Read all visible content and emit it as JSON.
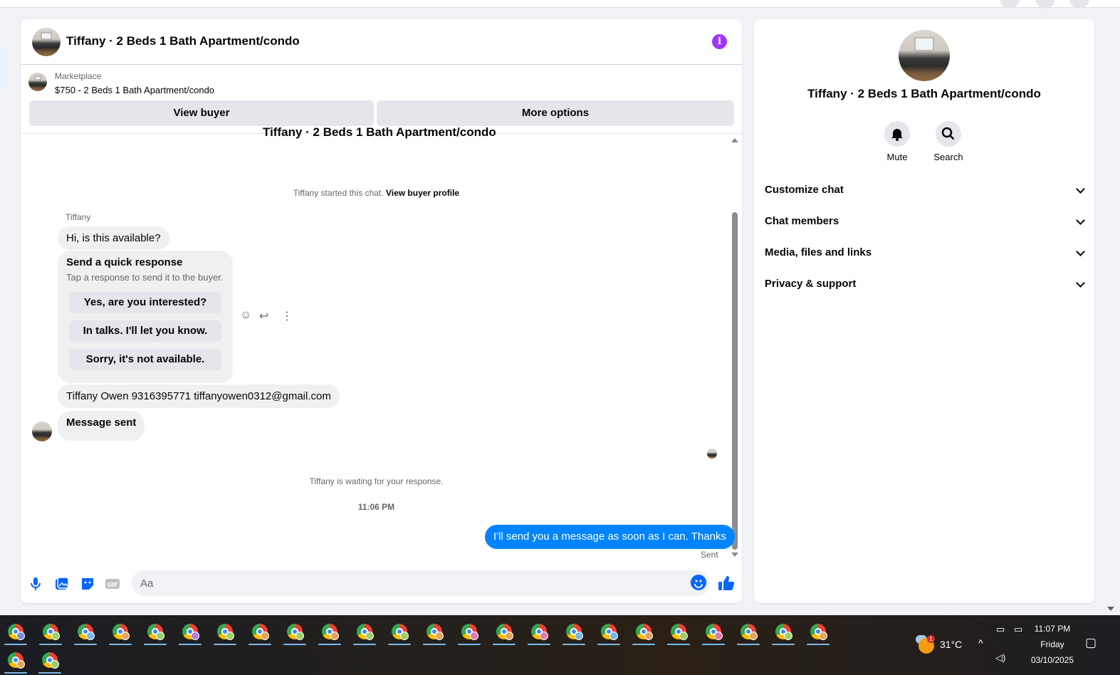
{
  "header": {
    "title": "Tiffany · 2 Beds 1 Bath Apartment/condo"
  },
  "listing": {
    "source": "Marketplace",
    "title": "$750 - 2 Beds 1 Bath Apartment/condo",
    "view_buyer": "View buyer",
    "more_options": "More options"
  },
  "conversation": {
    "clipped_title": "Tiffany · 2 Beds 1 Bath Apartment/condo",
    "started_text": "Tiffany started this chat.",
    "view_profile": "View buyer profile",
    "sender": "Tiffany",
    "first_message": "Hi, is this available?",
    "quick_response": {
      "title": "Send a quick response",
      "subtitle": "Tap a response to send it to the buyer.",
      "options": [
        "Yes, are you interested?",
        "In talks. I'll let you know.",
        "Sorry, it's not available."
      ]
    },
    "contact_message": "Tiffany Owen 9316395771 tiffanyowen0312@gmail.com",
    "message_sent": "Message sent",
    "waiting_text": "Tiffany is waiting for your response.",
    "timestamp": "11:06 PM",
    "outgoing": "I'll send you a message as soon as I can. Thanks",
    "status": "Sent"
  },
  "composer": {
    "placeholder": "Aa"
  },
  "side_panel": {
    "title": "Tiffany · 2 Beds 1 Bath Apartment/condo",
    "actions": [
      {
        "label": "Mute",
        "icon": "bell-icon"
      },
      {
        "label": "Search",
        "icon": "search-icon"
      }
    ],
    "sections": [
      "Customize chat",
      "Chat members",
      "Media, files and links",
      "Privacy & support"
    ]
  },
  "taskbar": {
    "weather": "31°C",
    "weather_badge": "1",
    "time": "11:07 PM",
    "day": "Friday",
    "date": "03/10/2025",
    "profile_badge_colors": [
      "#7b8fd6",
      "#9ecf6a",
      "#7ab7e8",
      "#e6a35a",
      "#9ecf6a",
      "#b57be0",
      "#9ecf6a",
      "#e6a35a",
      "#9ecf6a",
      "#e6a35a",
      "#9ecf6a",
      "#9ecf6a",
      "#e6a35a",
      "#e07ba9",
      "#e6a35a",
      "#e07ba9",
      "#7ab7e8",
      "#7ab7e8",
      "#e6a35a",
      "#9ecf6a",
      "#e07ba9",
      "#e6a35a",
      "#9ecf6a",
      "#e6a35a",
      "#e6a35a"
    ]
  },
  "colors": {
    "accent": "#0866ff",
    "outgoing_bubble": "#0084ff",
    "info": "#a033ff"
  }
}
